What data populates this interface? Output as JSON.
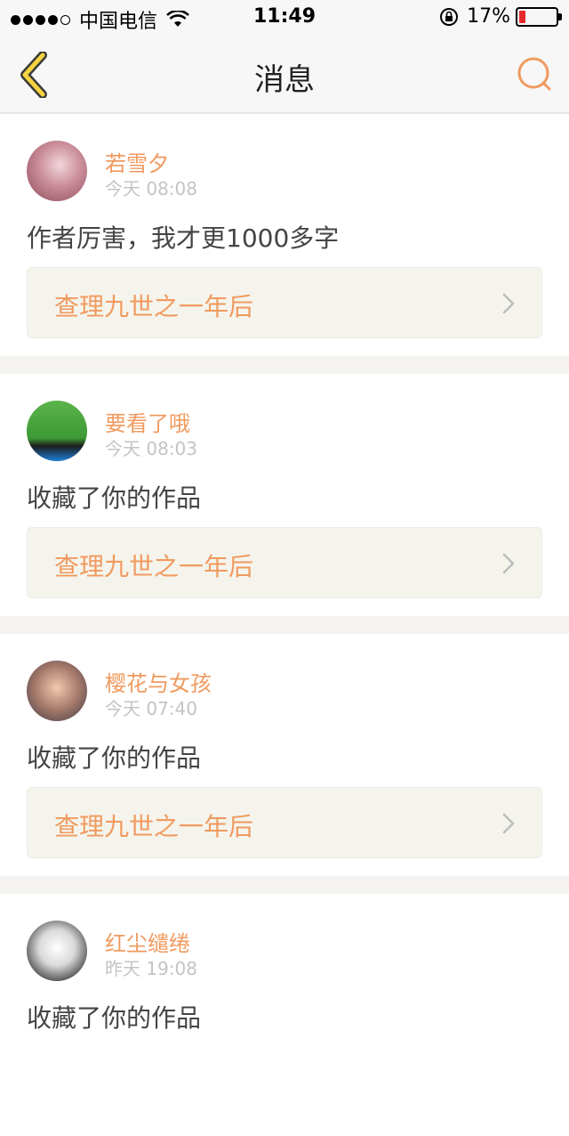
{
  "status_bar": {
    "carrier": "中国电信",
    "time": "11:49",
    "battery_percent": "17%",
    "battery_level": 0.17,
    "battery_color": "#e5292b"
  },
  "nav": {
    "title": "消息",
    "back_icon": "chevron-left-icon",
    "search_icon": "search-icon",
    "accent_color": "#f09a5f"
  },
  "messages": [
    {
      "username": "若雪夕",
      "time": "今天 08:08",
      "text": "作者厉害，我才更1000多字",
      "work_title": "查理九世之一年后"
    },
    {
      "username": "要看了哦",
      "time": "今天 08:03",
      "text": "收藏了你的作品",
      "work_title": "查理九世之一年后"
    },
    {
      "username": "樱花与女孩",
      "time": "今天 07:40",
      "text": "收藏了你的作品",
      "work_title": "查理九世之一年后"
    },
    {
      "username": "红尘缱绻",
      "time": "昨天 19:08",
      "text": "收藏了你的作品",
      "work_title": ""
    }
  ]
}
